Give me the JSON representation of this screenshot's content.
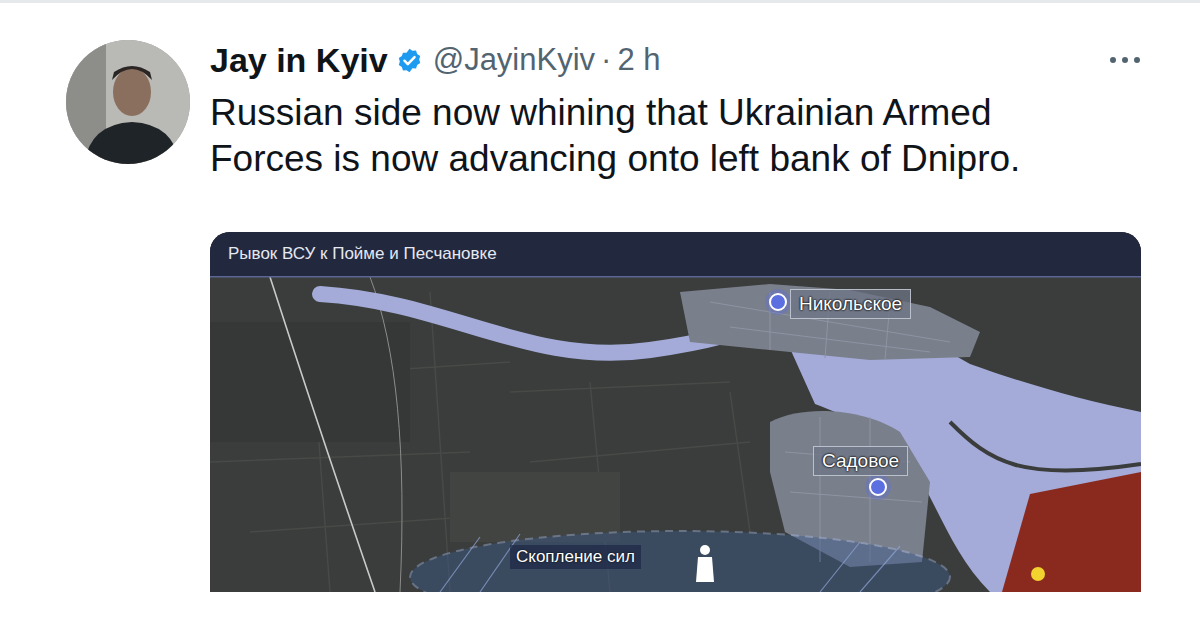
{
  "tweet": {
    "author": {
      "name": "Jay in Kyiv",
      "verified": true,
      "handle": "@JayinKyiv",
      "separator": "·",
      "time": "2 h"
    },
    "text": "Russian side now whining that Ukrainian Armed Forces is now advancing onto left bank of Dnipro."
  },
  "media": {
    "title": "Рывок ВСУ к Пойме и Песчановке",
    "places": [
      {
        "label": "Никольское"
      },
      {
        "label": "Садовое"
      }
    ],
    "annotation": "Скопление сил"
  }
}
